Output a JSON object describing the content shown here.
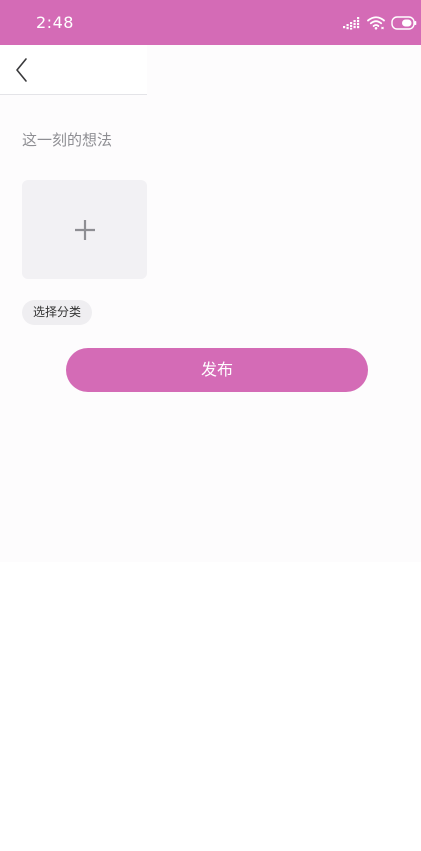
{
  "status_bar": {
    "time": "2:48",
    "icons": [
      "signal-icon",
      "wifi-icon",
      "battery-icon"
    ],
    "background_color": "#d46bb6"
  },
  "nav": {
    "back_icon": "chevron-left-icon"
  },
  "compose": {
    "prompt": "这一刻的想法",
    "add_photo_icon": "plus-icon",
    "category_label": "选择分类",
    "publish_label": "发布"
  },
  "colors": {
    "accent": "#d46bb6"
  }
}
